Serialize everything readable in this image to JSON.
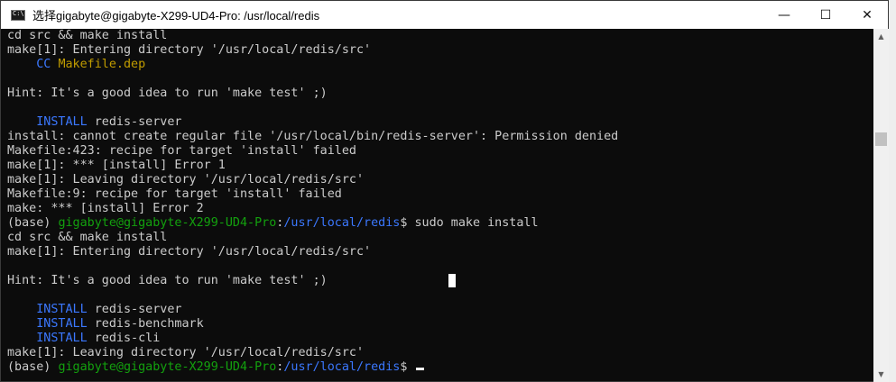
{
  "window": {
    "title": "选择gigabyte@gigabyte-X299-UD4-Pro: /usr/local/redis",
    "controls": {
      "minimize": "—",
      "maximize": "☐",
      "close": "✕"
    }
  },
  "terminal": {
    "l1": "cd src && make install",
    "l2": "make[1]: Entering directory '/usr/local/redis/src'",
    "l3_tag": "CC",
    "l3_file": "Makefile.dep",
    "l5": "Hint: It's a good idea to run 'make test' ;)",
    "l7_tag": "INSTALL",
    "l7_text": "redis-server",
    "l8": "install: cannot create regular file '/usr/local/bin/redis-server': Permission denied",
    "l9": "Makefile:423: recipe for target 'install' failed",
    "l10": "make[1]: *** [install] Error 1",
    "l11": "make[1]: Leaving directory '/usr/local/redis/src'",
    "l12": "Makefile:9: recipe for target 'install' failed",
    "l13": "make: *** [install] Error 2",
    "prompt_base": "(base)",
    "prompt_user": "gigabyte@gigabyte-X299-UD4-Pro",
    "prompt_sep": ":",
    "prompt_path": "/usr/local/redis",
    "prompt_dollar": "$",
    "cmd1": "sudo make install",
    "l15": "cd src && make install",
    "l16": "make[1]: Entering directory '/usr/local/redis/src'",
    "l18": "Hint: It's a good idea to run 'make test' ;)",
    "install_tag": "INSTALL",
    "inst1": "redis-server",
    "inst2": "redis-benchmark",
    "inst3": "redis-cli",
    "l23": "make[1]: Leaving directory '/usr/local/redis/src'"
  }
}
